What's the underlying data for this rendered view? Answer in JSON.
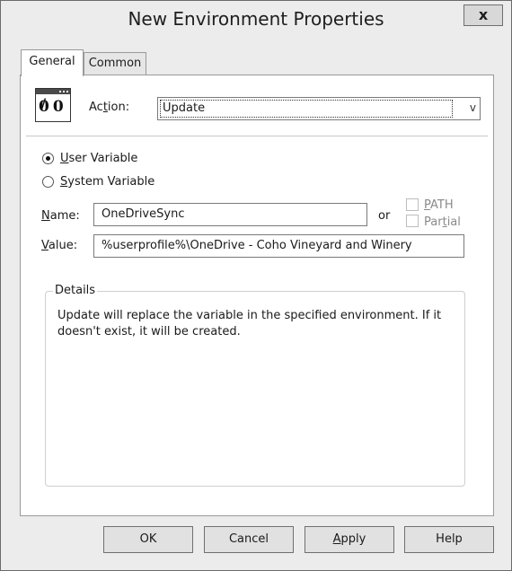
{
  "window": {
    "title": "New Environment Properties",
    "close_glyph": "x"
  },
  "tabs": [
    {
      "label": "General"
    },
    {
      "label": "Common"
    }
  ],
  "action": {
    "label_pre": "Ac",
    "label_key": "t",
    "label_post": "ion:",
    "icon_glyph": "%",
    "selected_value": "Update",
    "dropdown_glyph": "v"
  },
  "scope": {
    "user_variable": {
      "key": "U",
      "rest": "ser Variable",
      "checked": true
    },
    "system_variable": {
      "key": "S",
      "rest": "ystem Variable",
      "checked": false
    }
  },
  "name_field": {
    "key": "N",
    "rest": "ame:",
    "value": "OneDriveSync",
    "or_label": "or"
  },
  "path_option": {
    "key": "P",
    "rest": "ATH",
    "checked": false
  },
  "partial_option": {
    "pre": "Par",
    "key": "t",
    "rest": "ial",
    "checked": false
  },
  "value_field": {
    "key": "V",
    "rest": "alue:",
    "value": "%userprofile%\\OneDrive - Coho Vineyard and Winery"
  },
  "details": {
    "legend": "Details",
    "text": "Update will replace the variable in the specified environment. If it doesn't exist, it will be created."
  },
  "buttons": {
    "ok": "OK",
    "cancel": "Cancel",
    "apply": {
      "key": "A",
      "rest": "pply"
    },
    "help": "Help"
  }
}
